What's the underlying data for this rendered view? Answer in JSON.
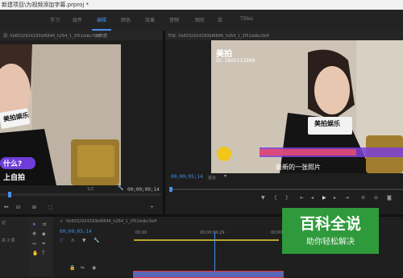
{
  "window": {
    "title": "新建项目\\为视频添加字幕.prproj *"
  },
  "workspace_tabs": [
    "学习",
    "组件",
    "编辑",
    "颜色",
    "效果",
    "音频",
    "图形",
    "库",
    "Titles"
  ],
  "source_panel": {
    "title": "源: 5b6032924293bf6846_h264_1_2f52ddbc5bff",
    "effect_controls_label": "元数据",
    "caption_question": "什么?",
    "caption_line": "上自拍",
    "badge_text": "美拍娱乐",
    "timecode_right": "00;00;09;14",
    "fit_label": "1/2"
  },
  "program_panel": {
    "title": "节目: 5b6032924293bf6846_h264_1_2f52ddbc5bff",
    "brand": "美拍",
    "id_text": "ID: 1605113269",
    "caption": "最新的一张照片",
    "badge_text": "美拍娱乐",
    "timecode": "00;00;05;14",
    "fit_label": "适合"
  },
  "project_panel": {
    "label_partial": "记",
    "item_partial": "共 2 项"
  },
  "timeline": {
    "sequence_name": "5b6032924293bf6846_h264_1_2f52ddbc5bff",
    "playhead_time": "00;00;05;14",
    "ruler_start": "00;00",
    "ruler_mid": "00;00;04;29",
    "ruler_end": "00;00;09;29"
  },
  "watermark": {
    "title": "百科全说",
    "subtitle": "助你轻松解决"
  },
  "colors": {
    "accent": "#4a8ee6",
    "caption_purple": "#6e3dd9",
    "watermark_green": "#2f9a3b"
  }
}
